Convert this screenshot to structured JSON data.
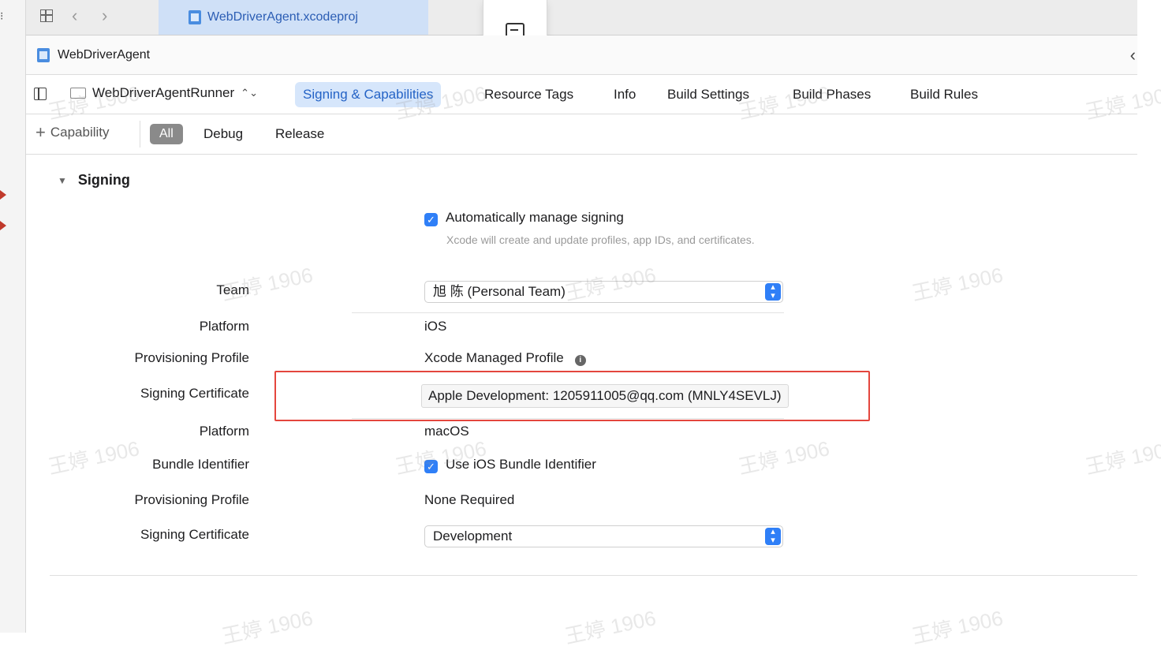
{
  "tab_bar": {
    "active_file": "WebDriverAgent.xcodeproj"
  },
  "jump_bar": {
    "project": "WebDriverAgent"
  },
  "editor": {
    "target": "WebDriverAgentRunner",
    "tabs": [
      "Signing & Capabilities",
      "Resource Tags",
      "Info",
      "Build Settings",
      "Build Phases",
      "Build Rules"
    ],
    "active_tab": "Signing & Capabilities"
  },
  "filters": {
    "add_capability": "Capability",
    "options": [
      "All",
      "Debug",
      "Release"
    ],
    "selected": "All"
  },
  "signing": {
    "section_title": "Signing",
    "auto_manage_label": "Automatically manage signing",
    "auto_manage_checked": true,
    "auto_manage_hint": "Xcode will create and update profiles, app IDs, and certificates.",
    "ios": {
      "team_label": "Team",
      "team_value": "旭 陈 (Personal Team)",
      "platform_label": "Platform",
      "platform_value": "iOS",
      "profile_label": "Provisioning Profile",
      "profile_value": "Xcode Managed Profile",
      "cert_label": "Signing Certificate",
      "cert_value": "Apple Development: 1205911005@qq.com (MNLY4SEVLJ)"
    },
    "macos": {
      "platform_label": "Platform",
      "platform_value": "macOS",
      "bundle_label": "Bundle Identifier",
      "bundle_value": "Use iOS Bundle Identifier",
      "bundle_checked": true,
      "profile_label": "Provisioning Profile",
      "profile_value": "None Required",
      "cert_label": "Signing Certificate",
      "cert_value": "Development"
    }
  },
  "watermark": "王婷 1906",
  "colors": {
    "accent": "#2f7ff7",
    "highlight_box": "#e4463d",
    "active_tab_bg": "#d6e6fb"
  }
}
